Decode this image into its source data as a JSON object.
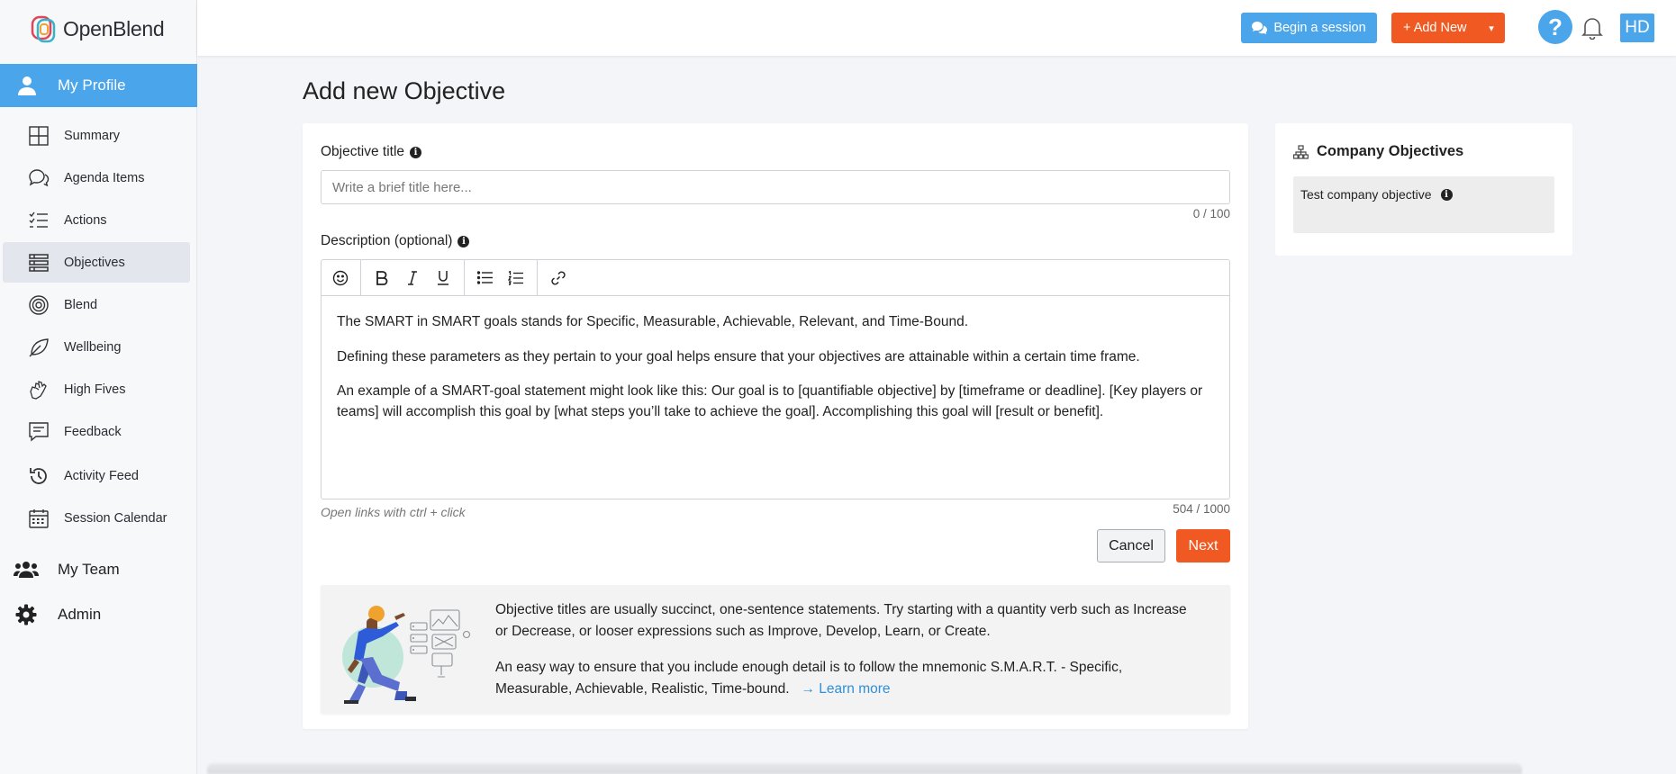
{
  "app": {
    "name": "OpenBlend",
    "brand_color": "#4aa5ea",
    "accent_color": "#f05a22"
  },
  "sidebar": {
    "profile_label": "My Profile",
    "items": [
      {
        "label": "Summary",
        "icon": "grid-icon"
      },
      {
        "label": "Agenda Items",
        "icon": "chat-bubbles-icon"
      },
      {
        "label": "Actions",
        "icon": "checklist-icon"
      },
      {
        "label": "Objectives",
        "icon": "objectives-icon",
        "active": true
      },
      {
        "label": "Blend",
        "icon": "target-icon"
      },
      {
        "label": "Wellbeing",
        "icon": "leaf-icon"
      },
      {
        "label": "High Fives",
        "icon": "high-five-icon"
      },
      {
        "label": "Feedback",
        "icon": "feedback-icon"
      },
      {
        "label": "Activity Feed",
        "icon": "history-icon"
      },
      {
        "label": "Session Calendar",
        "icon": "calendar-icon"
      }
    ],
    "team_label": "My Team",
    "admin_label": "Admin"
  },
  "header": {
    "begin_session": "Begin a session",
    "add_new": "+ Add New",
    "help": "?",
    "avatar": "HD"
  },
  "main": {
    "title": "Add new Objective",
    "objective_title_label": "Objective title",
    "objective_title_value": "",
    "objective_title_placeholder": "Write a brief title here...",
    "title_counter": "0 / 100",
    "description_label": "Description (optional)",
    "description_paragraphs": [
      "The SMART in SMART goals stands for Specific, Measurable, Achievable, Relevant, and Time-Bound.",
      "Defining these parameters as they pertain to your goal helps ensure that your objectives are attainable within a certain time frame.",
      "An example of a SMART-goal statement might look like this: Our goal is to [quantifiable objective] by [timeframe or deadline]. [Key players or teams] will accomplish this goal by [what steps you’ll take to achieve the goal]. Accomplishing this goal will [result or benefit]."
    ],
    "editor_hint": "Open links with ctrl + click",
    "description_counter": "504 / 1000",
    "cancel": "Cancel",
    "next": "Next",
    "tip_paragraph_1": "Objective titles are usually succinct, one-sentence statements. Try starting with a quantity verb such as Increase or Decrease, or looser expressions such as Improve, Develop, Learn, or Create.",
    "tip_paragraph_2": "An easy way to ensure that you include enough detail is to follow the mnemonic S.M.A.R.T. - Specific, Measurable, Achievable, Realistic, Time-bound.",
    "learn_more": "→ Learn more"
  },
  "company": {
    "title": "Company Objectives",
    "items": [
      {
        "label": "Test company objective"
      }
    ]
  }
}
